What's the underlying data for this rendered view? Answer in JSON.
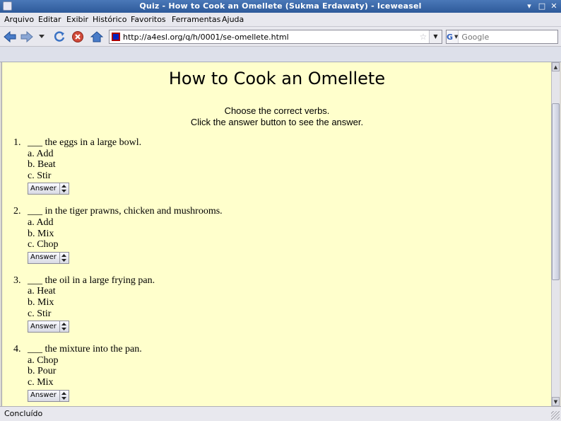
{
  "window": {
    "title": "Quiz - How to Cook an Omellete (Sukma Erdawaty) - Iceweasel",
    "icon": "iceweasel-icon",
    "controls": [
      "minimize-icon",
      "maximize-icon",
      "close-icon"
    ]
  },
  "menubar": {
    "items": [
      "Arquivo",
      "Editar",
      "Exibir",
      "Histórico",
      "Favoritos",
      "Ferramentas",
      "Ajuda"
    ]
  },
  "navbar": {
    "url": "http://a4esl.org/q/h/0001/se-omellete.html",
    "search_placeholder": "Google",
    "search_engine": "G"
  },
  "page": {
    "title": "How to Cook an Omellete",
    "instructions": [
      "Choose the correct verbs.",
      "Click the answer button to see the answer."
    ],
    "questions": [
      {
        "num": "1.",
        "text": "___ the eggs in a large bowl.",
        "options": [
          "a. Add",
          "b. Beat",
          "c. Stir"
        ],
        "answer_label": "Answer"
      },
      {
        "num": "2.",
        "text": "___ in the tiger prawns, chicken and mushrooms.",
        "options": [
          "a. Add",
          "b. Mix",
          "c. Chop"
        ],
        "answer_label": "Answer"
      },
      {
        "num": "3.",
        "text": "___ the oil in a large frying pan.",
        "options": [
          "a. Heat",
          "b. Mix",
          "c. Stir"
        ],
        "answer_label": "Answer"
      },
      {
        "num": "4.",
        "text": "___ the mixture into the pan.",
        "options": [
          "a. Chop",
          "b. Pour",
          "c. Mix"
        ],
        "answer_label": "Answer"
      }
    ]
  },
  "statusbar": {
    "status": "Concluído"
  },
  "colors": {
    "page_background": "#ffffcc",
    "titlebar": "#3a68a8"
  }
}
